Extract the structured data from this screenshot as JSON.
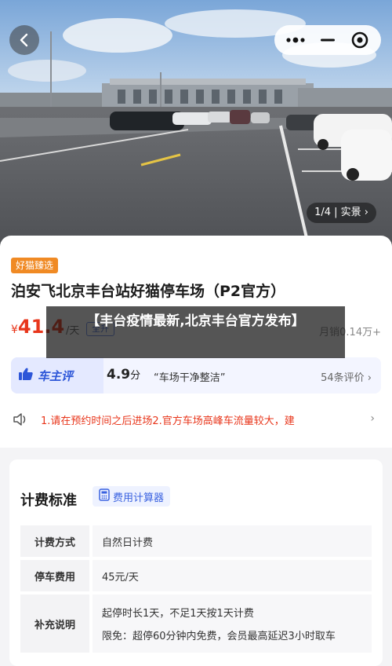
{
  "hero": {
    "counter": "1/4 | 实景 ›"
  },
  "nav": {
    "back_icon": "chevron-left-icon",
    "menu_icon": "more-dots-icon",
    "minimize_icon": "minus-icon",
    "close_icon": "target-circle-icon"
  },
  "lot": {
    "badge": "好猫臻选",
    "title": "泊安飞北京丰台站好猫停车场（P2官方）",
    "price_symbol": "¥",
    "price_value": "41.4",
    "price_unit": "/天",
    "price_tag": "全升",
    "sales": "月销0.14万+"
  },
  "overlay": {
    "text": "【丰台疫情最新,北京丰台官方发布】"
  },
  "review": {
    "brand": "车主评",
    "score": "4.9",
    "score_unit": "分",
    "quote": "“车场干净整洁”",
    "count": "54条评价 ›"
  },
  "notice": {
    "text": "1.请在预约时间之后进场2.官方车场高峰车流量较大，建",
    "chevron": "›"
  },
  "billing": {
    "title": "计费标准",
    "calculator_label": "费用计算器",
    "rows": [
      {
        "key": "计费方式",
        "value": "自然日计费"
      },
      {
        "key": "停车费用",
        "value": "45元/天"
      },
      {
        "key": "补充说明",
        "value": "起停时长1天，不足1天按1天计费",
        "value2": "限免：超停60分钟内免费，会员最高延迟3小时取车"
      }
    ]
  },
  "colors": {
    "accent_red": "#e8361b",
    "badge_orange": "#f08a24",
    "brand_blue": "#2d56d8"
  }
}
